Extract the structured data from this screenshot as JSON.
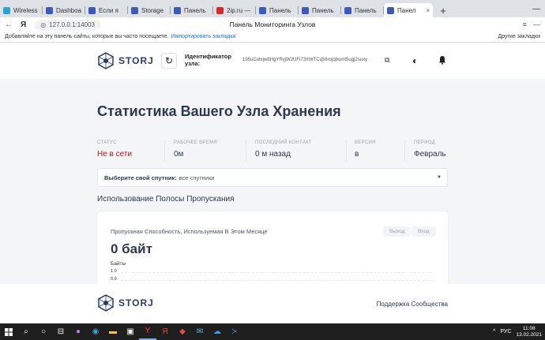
{
  "browser": {
    "tabs": [
      {
        "label": "Wireless",
        "color": "#2f9fd8"
      },
      {
        "label": "Dashboa",
        "color": "#3d5ab8"
      },
      {
        "label": "Если я",
        "color": "#3d5ab8"
      },
      {
        "label": "Storage",
        "color": "#3d5ab8"
      },
      {
        "label": "Панель",
        "color": "#3d5ab8"
      },
      {
        "label": "2ip.ru —",
        "color": "#d12b2b"
      },
      {
        "label": "Панель",
        "color": "#3d5ab8"
      },
      {
        "label": "Панель",
        "color": "#3d5ab8"
      },
      {
        "label": "Панель",
        "color": "#3d5ab8"
      },
      {
        "label": "Панел",
        "color": "#3d5ab8",
        "active": true
      }
    ],
    "active_tab_close": "×",
    "new_tab": "+",
    "url": "127.0.0.1:14003",
    "page_title": "Панель Мониторинга Узлов",
    "yandex_label": "Я",
    "bookmarks_prompt": "Добавляйте на эту панель сайты, которые вы часто посещаете.",
    "bookmarks_import": "Импортировать закладки",
    "other_bookmarks": "Другие закладки"
  },
  "header": {
    "logo_text": "STORJ",
    "node_id_label": "Идентификатор узла:",
    "node_id_value": "195uCutxjw8HgYRyjW2UFi73XWTCq56rojqbomt5ugj2suxy"
  },
  "main": {
    "title": "Статистика Вашего Узла Хранения",
    "stats": [
      {
        "label": "СТАТУС",
        "value": "Не в сети",
        "offline": true
      },
      {
        "label": "РАБОЧЕЕ ВРЕМЯ",
        "value": "0м"
      },
      {
        "label": "ПОСЛЕДНИЙ КОНТАКТ",
        "value": "0 м назад"
      },
      {
        "label": "ВЕРСИЯ",
        "value": "в"
      },
      {
        "label": "ПЕРИОД",
        "value": "Февраль"
      }
    ],
    "satellite": {
      "label": "Выберите свой спутник:",
      "value": "все спутники"
    },
    "bandwidth_title": "Использование Полосы Пропускания",
    "card": {
      "title": "Пропускная Способность, Используемая В Этом Месяце",
      "egress_button": "Выход",
      "ingress_button": "Вход",
      "amount": "0 байт",
      "y_label": "Байты",
      "ticks": [
        "1.0",
        "0.9"
      ]
    }
  },
  "footer": {
    "logo_text": "STORJ",
    "support_link": "Поддержка Сообщества"
  },
  "taskbar": {
    "lang": "РУС",
    "time": "11:08",
    "date": "13.02.2021"
  }
}
